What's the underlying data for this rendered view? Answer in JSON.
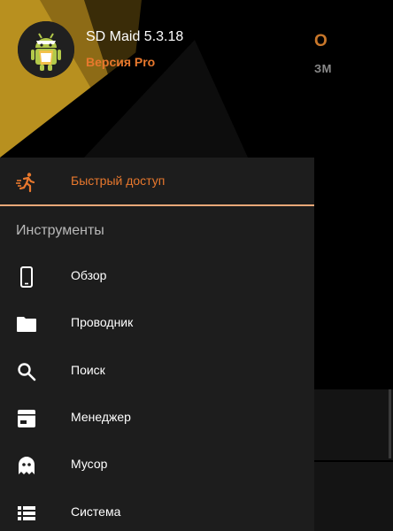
{
  "header": {
    "app_name": "SD Maid 5.3.18",
    "edition": "Версия Pro"
  },
  "background": {
    "title_fragment": "O",
    "subtitle_fragment": "ЗМ"
  },
  "menu": {
    "quick_access": {
      "label": "Быстрый доступ",
      "icon": "running-man-icon"
    },
    "tools_section_title": "Инструменты",
    "items": [
      {
        "label": "Обзор",
        "icon": "smartphone-icon"
      },
      {
        "label": "Проводник",
        "icon": "folder-icon"
      },
      {
        "label": "Поиск",
        "icon": "search-icon"
      },
      {
        "label": "Менеджер",
        "icon": "app-manager-icon"
      },
      {
        "label": "Мусор",
        "icon": "ghost-icon"
      },
      {
        "label": "Система",
        "icon": "list-icon"
      }
    ]
  },
  "colors": {
    "accent": "#e8782d",
    "drawer_bg": "#1d1d1d",
    "header_bg": "#000000",
    "header_shape": "#c89a2a"
  }
}
